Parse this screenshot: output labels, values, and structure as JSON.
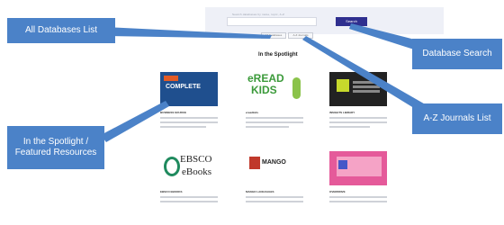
{
  "search": {
    "hint_text": "Search databases by name, topic, A-Z",
    "button_label": "Search",
    "all_db_button_label": "All Databases",
    "az_button_label": "A-Z Journals"
  },
  "spotlight": {
    "title": "In the Spotlight",
    "cards": [
      {
        "title": "BUSINESS SOURCE",
        "logo_text": "COMPLETE"
      },
      {
        "title": "ereadkids",
        "logo_text_1": "eREAD",
        "logo_text_2": "KIDS"
      },
      {
        "title": "INSIGHTS LIBRARY"
      },
      {
        "title": "EBSCO EBOOKS",
        "logo_text_1": "EBSCO",
        "logo_text_2": "eBooks"
      },
      {
        "title": "MANGO LANGUAGES",
        "logo_text": "MANGO"
      },
      {
        "title": "OVERDRIVE"
      }
    ]
  },
  "callouts": {
    "all_databases": "All Databases List",
    "database_search": "Database Search",
    "az_journals": "A-Z Journals List",
    "spotlight": "In the Spotlight / Featured Resources"
  },
  "colors": {
    "callout": "#4b82c8",
    "search_button": "#2f2f8f"
  }
}
